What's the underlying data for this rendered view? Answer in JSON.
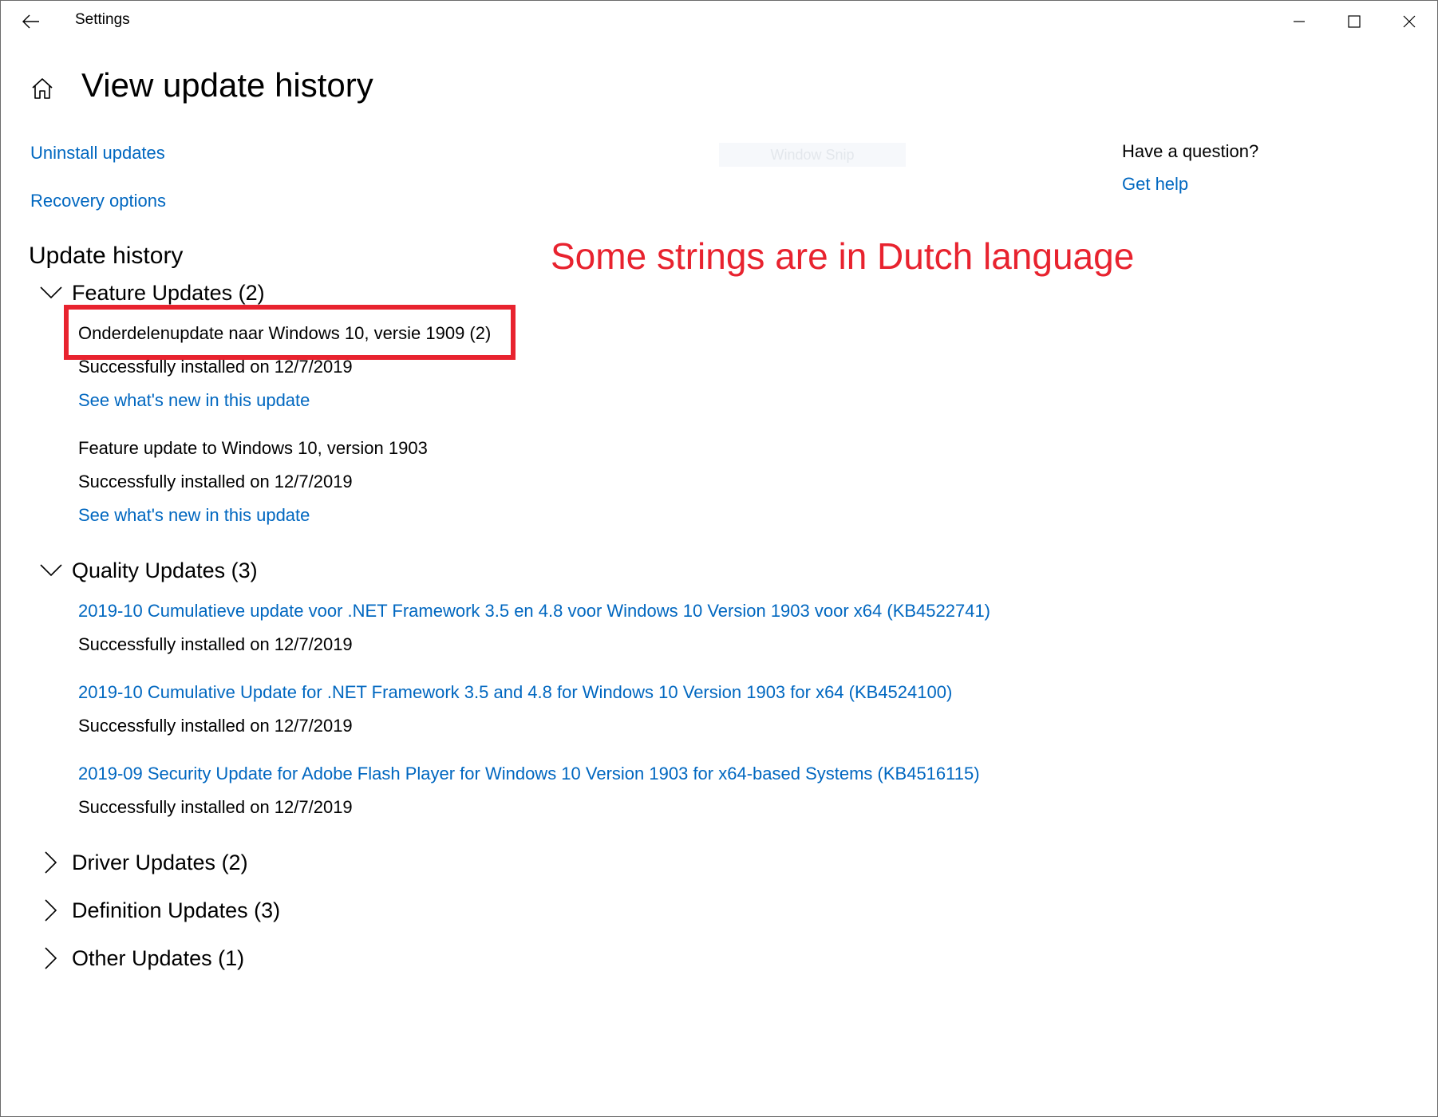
{
  "window": {
    "title": "Settings"
  },
  "header": {
    "page_title": "View update history"
  },
  "links": {
    "uninstall": "Uninstall updates",
    "recovery": "Recovery options"
  },
  "watermark": "Window Snip",
  "help": {
    "question": "Have a question?",
    "get_help": "Get help"
  },
  "annotation": {
    "text": "Some strings are in Dutch language",
    "color": "#e8232f"
  },
  "update_history": {
    "title": "Update history",
    "groups": [
      {
        "label": "Feature Updates (2)",
        "expanded": true,
        "items": [
          {
            "title": "Onderdelenupdate naar Windows 10, versie 1909 (2)",
            "status": "Successfully installed on 12/7/2019",
            "link": "See what's new in this update"
          },
          {
            "title": "Feature update to Windows 10, version 1903",
            "status": "Successfully installed on 12/7/2019",
            "link": "See what's new in this update"
          }
        ]
      },
      {
        "label": "Quality Updates (3)",
        "expanded": true,
        "items": [
          {
            "title": "2019-10 Cumulatieve update voor .NET Framework 3.5 en 4.8 voor Windows 10 Version 1903 voor x64 (KB4522741)",
            "status": "Successfully installed on 12/7/2019"
          },
          {
            "title": "2019-10 Cumulative Update for .NET Framework 3.5 and 4.8 for Windows 10 Version 1903 for x64 (KB4524100)",
            "status": "Successfully installed on 12/7/2019"
          },
          {
            "title": "2019-09 Security Update for Adobe Flash Player for Windows 10 Version 1903 for x64-based Systems (KB4516115)",
            "status": "Successfully installed on 12/7/2019"
          }
        ]
      },
      {
        "label": "Driver Updates (2)",
        "expanded": false
      },
      {
        "label": "Definition Updates (3)",
        "expanded": false
      },
      {
        "label": "Other Updates (1)",
        "expanded": false
      }
    ]
  },
  "colors": {
    "link": "#0067c0",
    "text": "#000000",
    "annotation": "#e8232f"
  }
}
